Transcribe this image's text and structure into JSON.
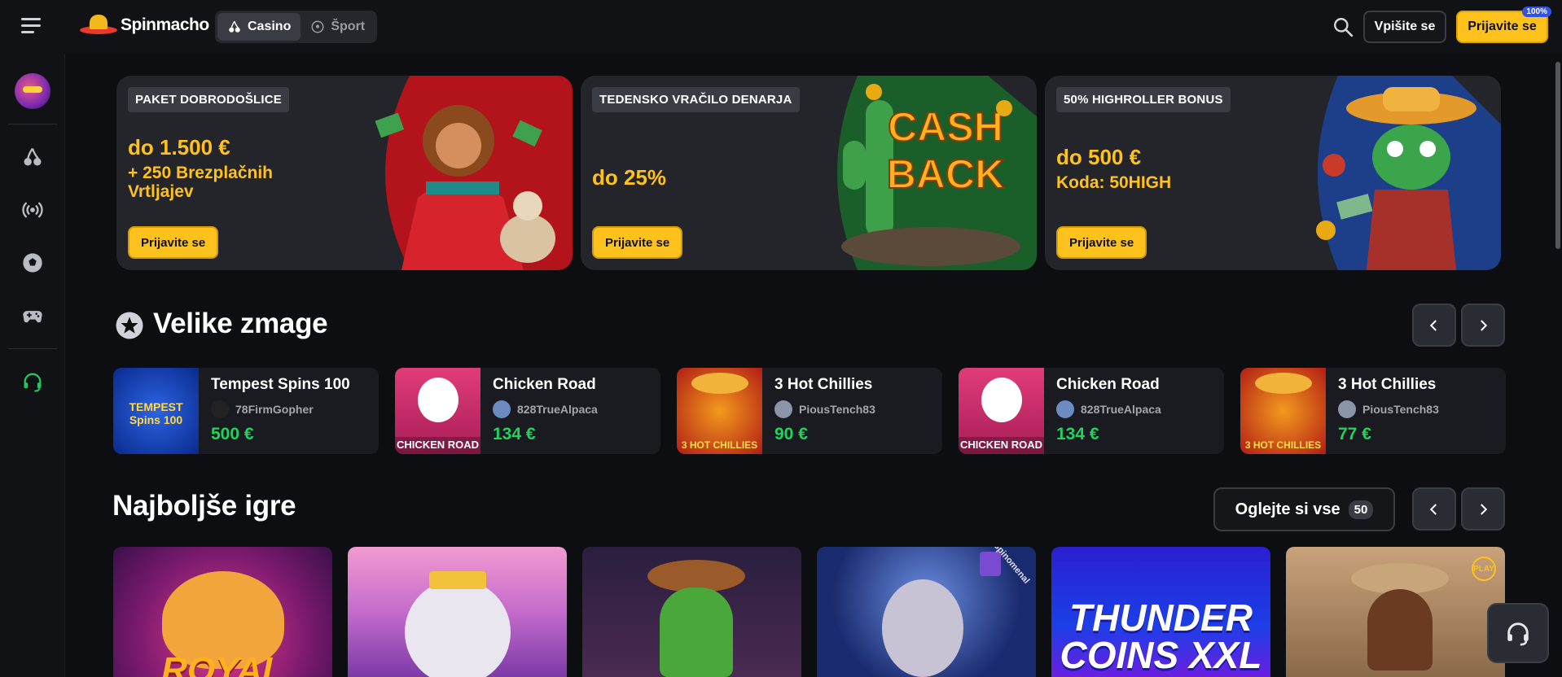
{
  "header": {
    "logo_text": "Spinmacho",
    "tabs": [
      {
        "label": "Casino"
      },
      {
        "label": "Šport"
      }
    ],
    "login_label": "Vpišite se",
    "register_label": "Prijavite se",
    "register_badge": "100%"
  },
  "promos": [
    {
      "tag": "PAKET DOBRODOŠLICE",
      "title": "do 1.500 €",
      "subtitle": "+ 250 Brezplačnih Vrtljajev",
      "button": "Prijavite se"
    },
    {
      "tag": "TEDENSKO VRAČILO DENARJA",
      "title": "do 25%",
      "subtitle": "",
      "button": "Prijavite se",
      "art_text": "CASH BACK"
    },
    {
      "tag": "50% HIGHROLLER BONUS",
      "title": "do 500 €",
      "subtitle": "Koda: 50HIGH",
      "button": "Prijavite se"
    }
  ],
  "big_wins": {
    "title": "Velike zmage",
    "items": [
      {
        "game": "Tempest Spins 100",
        "user": "78FirmGopher",
        "amount": "500 €",
        "thumb_text": "TEMPEST Spins 100"
      },
      {
        "game": "Chicken Road",
        "user": "828TrueAlpaca",
        "amount": "134 €",
        "thumb_text": "CHICKEN ROAD"
      },
      {
        "game": "3 Hot Chillies",
        "user": "PiousTench83",
        "amount": "90 €",
        "thumb_text": "3 HOT CHILLIES"
      },
      {
        "game": "Chicken Road",
        "user": "828TrueAlpaca",
        "amount": "134 €",
        "thumb_text": "CHICKEN ROAD"
      },
      {
        "game": "3 Hot Chillies",
        "user": "PiousTench83",
        "amount": "77 €",
        "thumb_text": "3 HOT CHILLIES"
      }
    ]
  },
  "top_games": {
    "title": "Najboljše igre",
    "see_all_label": "Oglejte si vse",
    "count": "50",
    "tiles": [
      {
        "label": "ROYAL"
      },
      {
        "label": ""
      },
      {
        "label": ""
      },
      {
        "label": "",
        "provider": "Spinomenal"
      },
      {
        "label": "THUNDER COINS XXL"
      },
      {
        "label": "",
        "provider": "PLAY"
      }
    ]
  },
  "colors": {
    "accent": "#ffc21d",
    "win_green": "#1fd35d",
    "bg": "#0d0e12"
  }
}
